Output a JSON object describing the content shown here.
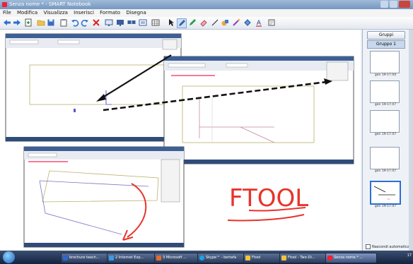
{
  "window": {
    "title": "Senza nome * - SMART Notebook"
  },
  "menu": [
    "File",
    "Modifica",
    "Visualizza",
    "Inserisci",
    "Formato",
    "Disegna"
  ],
  "toolbar_icons": [
    "back-arrow-icon",
    "forward-arrow-icon",
    "add-page-icon",
    "open-folder-icon",
    "save-icon",
    "paste-icon",
    "undo-icon",
    "redo-icon",
    "delete-icon",
    "screen-shade-icon",
    "full-screen-icon",
    "dual-display-icon",
    "capture-icon",
    "table-icon",
    "select-arrow-icon",
    "pen-icon",
    "creative-pen-icon",
    "eraser-icon",
    "line-icon",
    "shapes-icon",
    "magic-pen-icon",
    "fill-icon",
    "text-icon",
    "properties-icon"
  ],
  "canvas": {
    "handwriting": "FTOOL"
  },
  "sidepanel": {
    "groups_button": "Gruppi",
    "group_label": "Gruppo 1",
    "thumbnails": [
      {
        "label": "gen 19-17.04"
      },
      {
        "label": "gen 19-17.07"
      },
      {
        "label": "gen 19-17.07"
      },
      {
        "label": "gen 19-17.07"
      },
      {
        "label": "gen 19-17.07"
      }
    ],
    "autohide_label": "Nascondi automatica"
  },
  "taskbar": {
    "tasks": [
      {
        "label": "brochure teach..."
      },
      {
        "label": "2 Internet Exp..."
      },
      {
        "label": "3 Microsoft ..."
      },
      {
        "label": "Skype™ - bertafa"
      },
      {
        "label": "Ftool"
      },
      {
        "label": "Ftool - Two-Di..."
      },
      {
        "label": "Senza nome * ..."
      }
    ],
    "clock": "17"
  },
  "colors": {
    "handwriting": "#e8332a",
    "arrow": "#111111",
    "selection": "#2b6fd6"
  }
}
